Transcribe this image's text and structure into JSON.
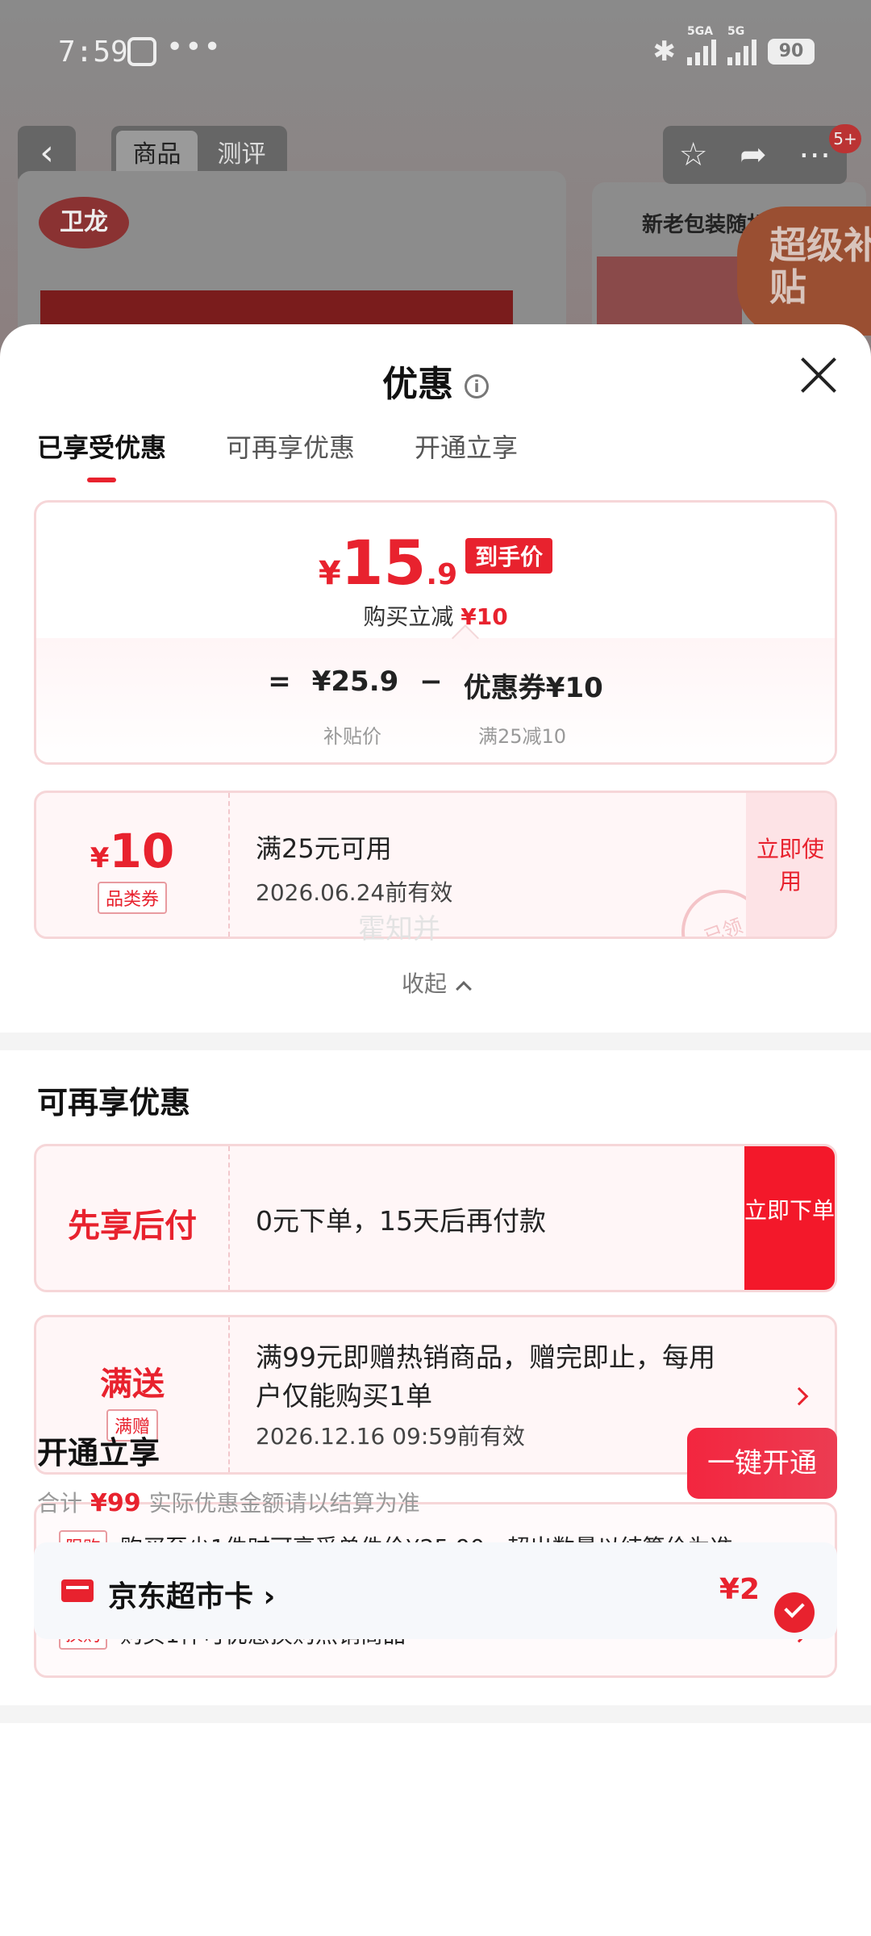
{
  "status_bar": {
    "time": "7:59",
    "dots": "•••",
    "signal1": "5GA",
    "signal2": "5G",
    "battery": "90"
  },
  "background": {
    "tab_product": "商品",
    "tab_review": "测评",
    "brand_logo": "卫龙",
    "right_card_title": "新老包装随机发",
    "super_badge": "超级补贴",
    "badge_count": "5+"
  },
  "sheet": {
    "title": "优惠",
    "tabs": [
      "已享受优惠",
      "可再享优惠",
      "开通立享"
    ]
  },
  "price_card": {
    "yen": "¥",
    "price_int": "15",
    "price_dec": ".9",
    "price_tag": "到手价",
    "sub_text": "购买立减",
    "sub_amount": "¥10",
    "eq": "=",
    "base_price": "¥25.9",
    "minus": "−",
    "coupon_term": "优惠券¥10",
    "base_label": "补贴价",
    "coupon_label": "满25减10"
  },
  "coupon": {
    "yen": "¥",
    "amount": "10",
    "type": "品类券",
    "condition": "满25元可用",
    "expiry": "2026.06.24前有效",
    "stamp": "已领",
    "cta": "立即使用"
  },
  "watermark": "霍知并",
  "collapse_label": "收起",
  "more_offers": {
    "title": "可再享优惠",
    "paylater": {
      "label": "先享后付",
      "text": "0元下单，15天后再付款",
      "cta": "立即下单"
    },
    "gift": {
      "label": "满送",
      "sub": "满赠",
      "line1": "满99元即赠热销商品，赠完即止，每用",
      "line2": "户仅能购买1单",
      "expiry": "2026.12.16 09:59前有效"
    },
    "limits": [
      {
        "tag": "限购",
        "text": "购买至少1件时可享受单件价¥25.90，超出数量以结算价为准"
      },
      {
        "tag": "换购",
        "text": "购买1件可优惠换购热销商品"
      }
    ]
  },
  "open_section": {
    "title": "开通立享",
    "total_prefix": "合计",
    "total_amount": "¥99",
    "total_note": "实际优惠金额请以结算为准",
    "button": "一键开通",
    "card_label": "京东超市卡 ›",
    "card_price": "¥2"
  },
  "colors": {
    "accent": "#e8222e",
    "card_border": "#f6d6d8",
    "card_bg": "#fff6f7"
  }
}
